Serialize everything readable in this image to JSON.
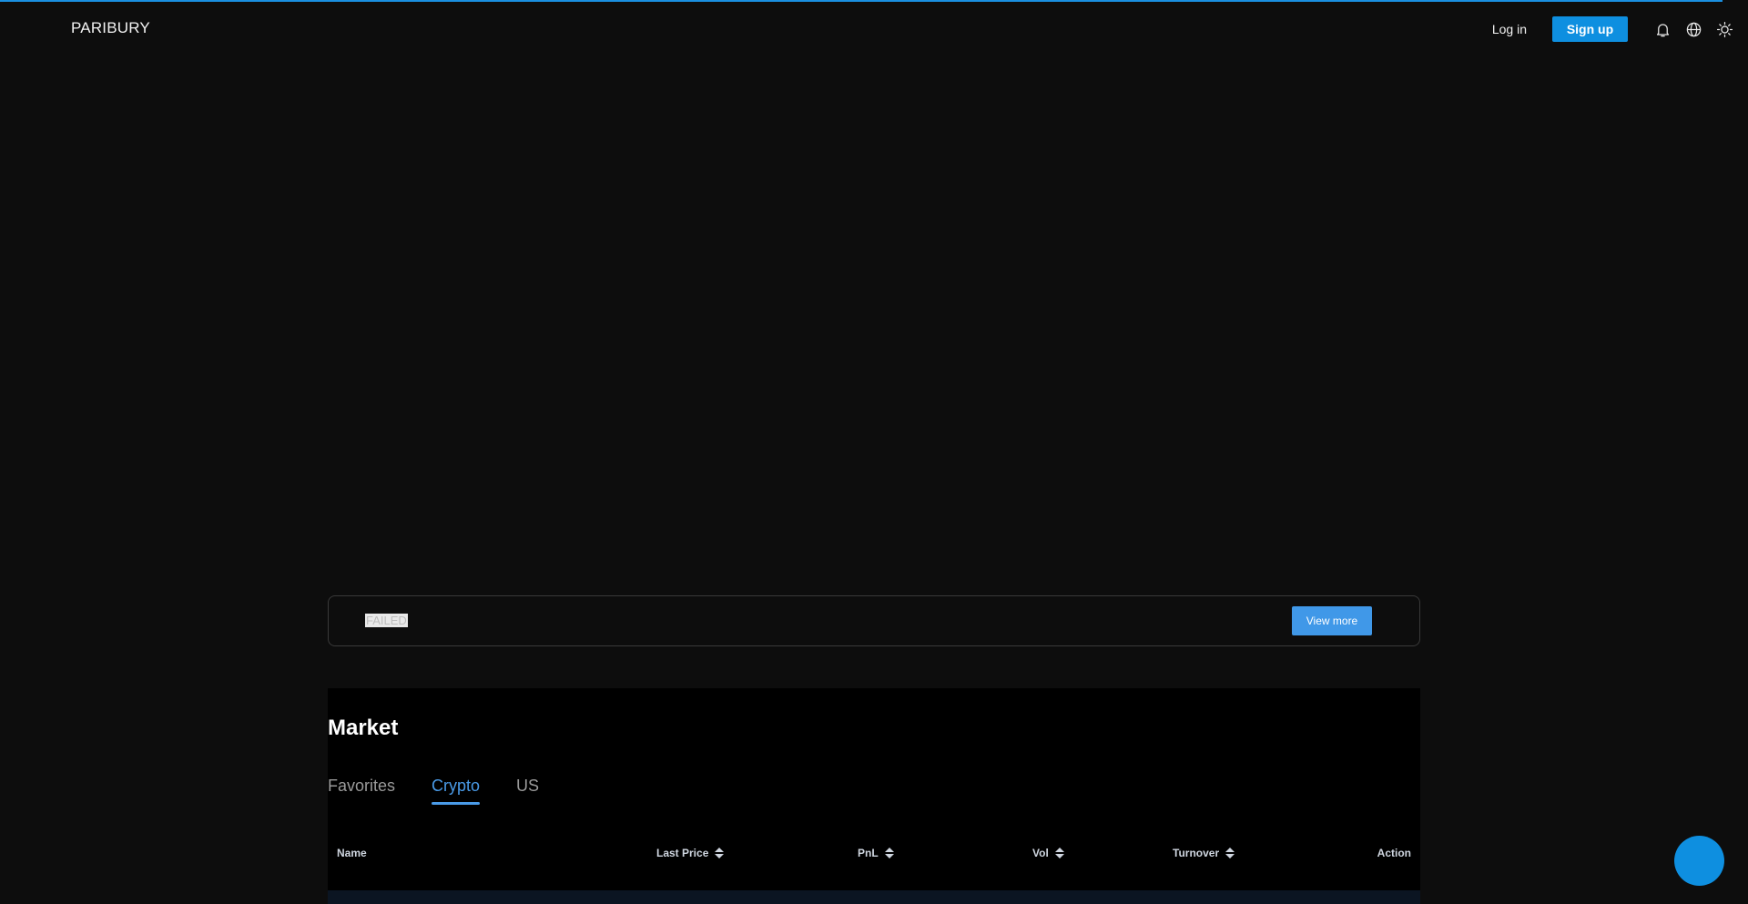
{
  "header": {
    "logo": "PARIBURY",
    "login_label": "Log in",
    "signup_label": "Sign up",
    "icons": [
      "bell-icon",
      "globe-icon",
      "sun-icon"
    ]
  },
  "notice": {
    "text": "FAILED",
    "view_more_label": "View more"
  },
  "market": {
    "title": "Market",
    "tabs": [
      {
        "label": "Favorites",
        "active": false
      },
      {
        "label": "Crypto",
        "active": true
      },
      {
        "label": "US",
        "active": false
      }
    ],
    "columns": {
      "name": "Name",
      "last_price": "Last Price",
      "pnl": "PnL",
      "vol": "Vol",
      "turnover": "Turnover",
      "action": "Action"
    }
  },
  "colors": {
    "accent": "#0e8fe0",
    "tab_active": "#4a9be8",
    "background": "#0d0d0d"
  }
}
